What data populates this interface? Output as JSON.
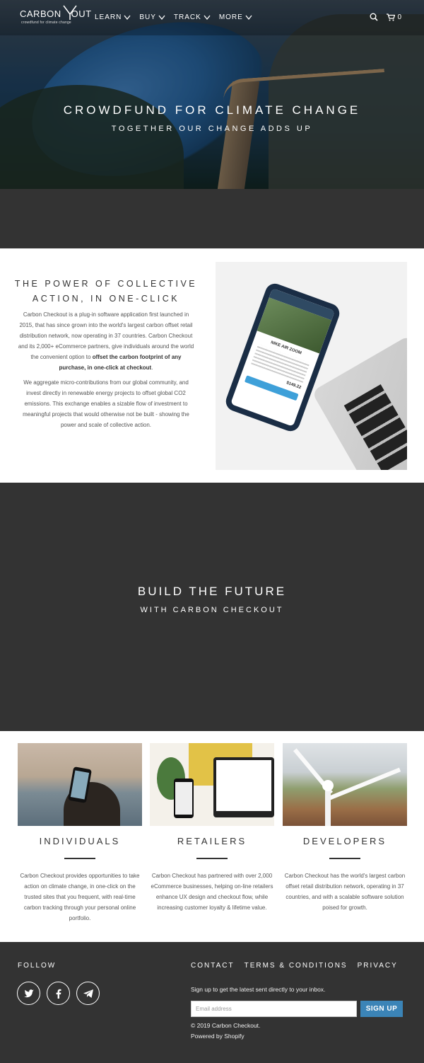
{
  "brand": {
    "name": "CARBON",
    "name2": "OUT",
    "tagline": "crowdfund for climate change"
  },
  "nav": {
    "items": [
      {
        "label": "LEARN"
      },
      {
        "label": "BUY"
      },
      {
        "label": "TRACK"
      },
      {
        "label": "MORE"
      }
    ],
    "cart_count": "0"
  },
  "hero": {
    "title": "CROWDFUND FOR CLIMATE CHANGE",
    "subtitle": "TOGETHER OUR CHANGE ADDS UP"
  },
  "power": {
    "title_line1": "THE POWER OF COLLECTIVE",
    "title_line2": "ACTION, IN ONE-CLICK",
    "p1": "Carbon Checkout is a plug-in software application first launched in 2015, that has since grown into the world's largest carbon offset retail distribution network, now operating in 37 countries. Carbon Checkout and its 2,000+ eCommerce partners, give individuals around the world the convenient option to ",
    "p1_bold": "offset the carbon footprint of any purchase, in one-click at checkout",
    "p1_end": ".",
    "p2": "We aggregate micro-contributions from our global community, and invest directly in renewable energy projects to offset global CO2 emissions. This exchange enables a sizable flow of investment to meaningful projects that would otherwise not be built - showing the power and scale of collective action.",
    "phone": {
      "product": "NIKE AIR ZOOM",
      "price": "$149.22"
    }
  },
  "future": {
    "title": "BUILD THE FUTURE",
    "subtitle": "WITH CARBON CHECKOUT"
  },
  "columns": [
    {
      "title": "INDIVIDUALS",
      "text": "Carbon Checkout provides opportunities to take action on climate change, in one-click on the trusted sites that you frequent, with real-time carbon tracking through your personal online portfolio."
    },
    {
      "title": "RETAILERS",
      "text": "Carbon Checkout has partnered with over 2,000 eCommerce businesses, helping on-line retailers enhance UX design and checkout flow, while increasing customer loyalty & lifetime value."
    },
    {
      "title": "DEVELOPERS",
      "text": "Carbon Checkout has the world's largest carbon offset retail distribution network, operating in 37 countries, and with a scalable software solution poised for growth."
    }
  ],
  "footer": {
    "follow": "FOLLOW",
    "social": [
      "twitter-icon",
      "facebook-icon",
      "telegram-icon"
    ],
    "links": [
      {
        "label": "CONTACT"
      },
      {
        "label": "TERMS & CONDITIONS"
      },
      {
        "label": "PRIVACY"
      }
    ],
    "note": "Sign up to get the latest sent directly to your inbox.",
    "email_placeholder": "Email address",
    "signup": "SIGN UP",
    "copyright": "© 2019 Carbon Checkout.",
    "powered": "Powered by Shopify"
  },
  "colors": {
    "dark_band": "#333333",
    "accent": "#3b84b7"
  }
}
